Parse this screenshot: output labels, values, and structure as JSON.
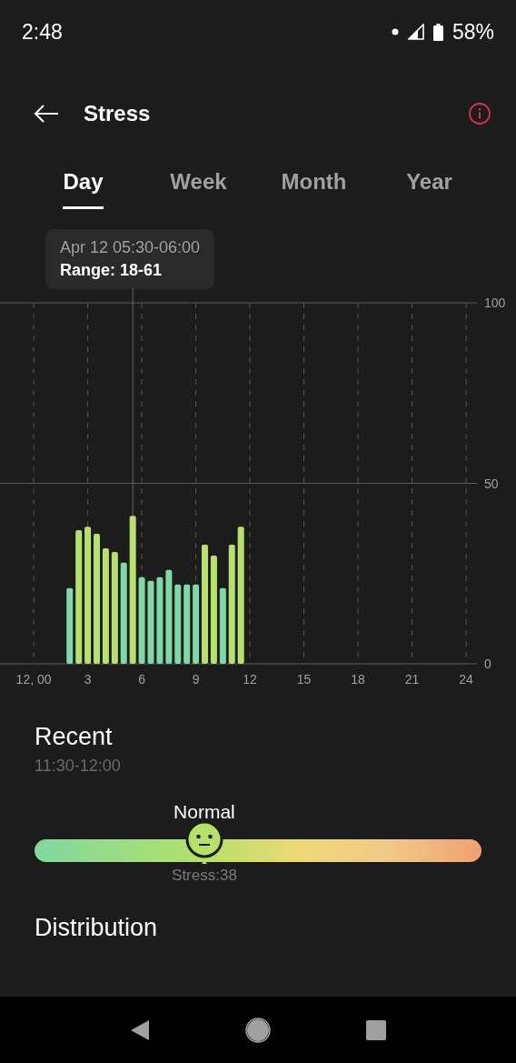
{
  "status_bar": {
    "time": "2:48",
    "battery": "58%"
  },
  "header": {
    "title": "Stress"
  },
  "tabs": [
    {
      "label": "Day",
      "selected": true
    },
    {
      "label": "Week",
      "selected": false
    },
    {
      "label": "Month",
      "selected": false
    },
    {
      "label": "Year",
      "selected": false
    }
  ],
  "tooltip": {
    "time": "Apr 12 05:30-06:00",
    "range": "Range: 18-61"
  },
  "chart": {
    "chart_data": {
      "type": "bar",
      "x": [
        2,
        2.5,
        3,
        3.5,
        4,
        4.5,
        5,
        5.5,
        6,
        6.5,
        7,
        7.5,
        8,
        8.5,
        9,
        9.5,
        10,
        10.5,
        11,
        11.5
      ],
      "series": [
        {
          "color": "#80d8a8",
          "values": [
            21,
            null,
            null,
            null,
            null,
            null,
            28,
            null,
            24,
            23,
            24,
            26,
            22,
            22,
            22,
            null,
            null,
            21,
            null,
            null
          ]
        },
        {
          "color": "#b8e070",
          "values": [
            null,
            37,
            38,
            36,
            32,
            31,
            null,
            41,
            null,
            null,
            null,
            null,
            null,
            null,
            null,
            33,
            30,
            null,
            33,
            38
          ]
        }
      ],
      "grid": true,
      "xlim": [
        -1.87,
        24.6
      ],
      "ylim": [
        0,
        100
      ],
      "xticks": [
        {
          "value": 0,
          "label": "12, 00"
        },
        3,
        6,
        9,
        12,
        15,
        18,
        21,
        24
      ],
      "yticks": [
        0,
        50,
        100
      ],
      "ref_lines": [
        {
          "axis": "x",
          "value": 5.5
        },
        {
          "axis": "y",
          "value": 50
        }
      ]
    }
  },
  "recent": {
    "title": "Recent",
    "time": "11:30-12:00",
    "status": "Normal",
    "level": 0.38,
    "reading": "Stress:38"
  },
  "distribution": {
    "title": "Distribution"
  }
}
